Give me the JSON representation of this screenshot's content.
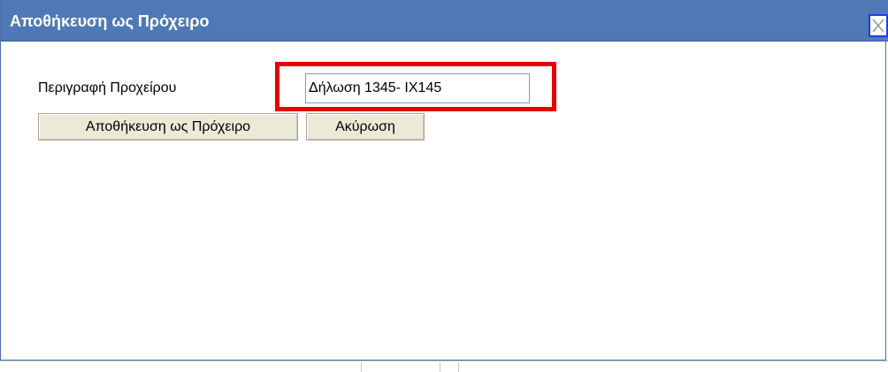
{
  "dialog": {
    "title": "Αποθήκευση ως Πρόχειρο",
    "close_icon": "close-x-icon"
  },
  "form": {
    "description_label": "Περιγραφή Προχείρου",
    "description_value": "Δήλωση 1345- ΙΧ145"
  },
  "buttons": {
    "save_draft": "Αποθήκευση ως Πρόχειρο",
    "cancel": "Ακύρωση"
  },
  "colors": {
    "titlebar": "#4f79b6",
    "highlight": "#e60000",
    "close_border": "#1f3de0"
  }
}
